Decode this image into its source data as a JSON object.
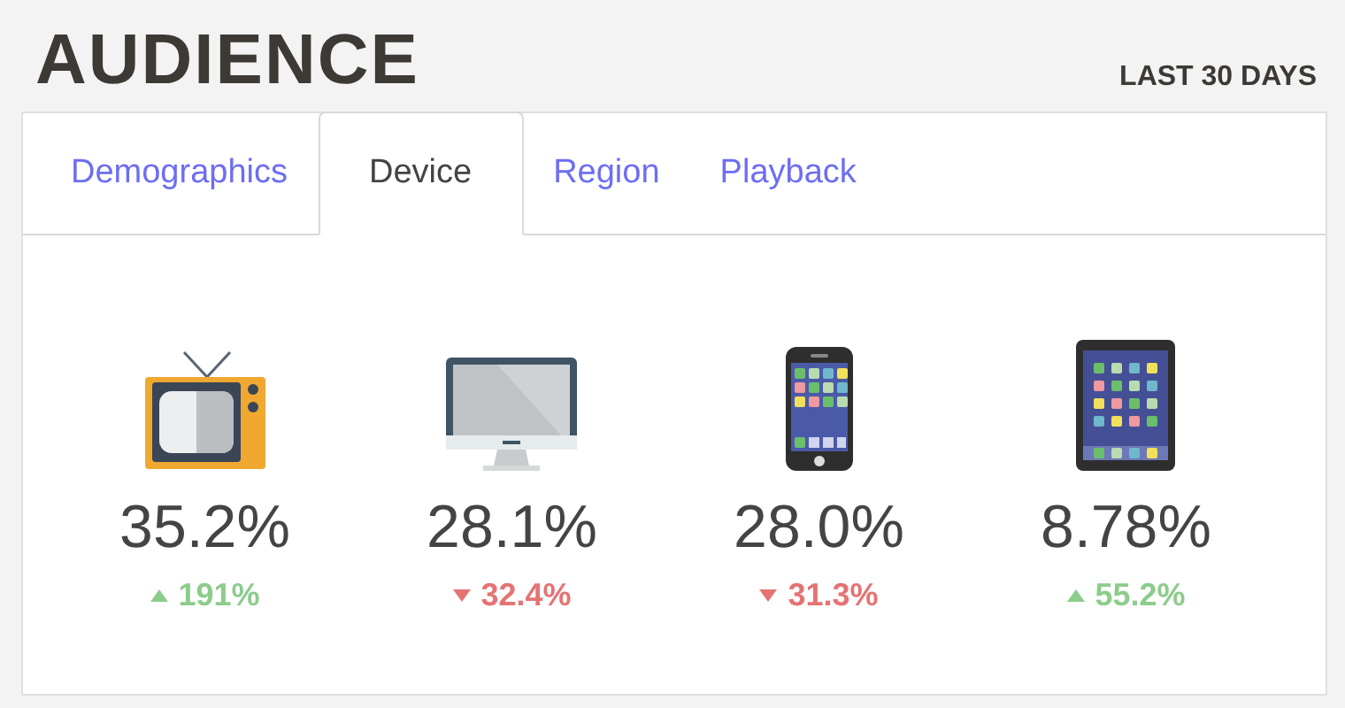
{
  "header": {
    "title": "AUDIENCE",
    "period": "LAST 30 DAYS"
  },
  "tabs": [
    {
      "label": "Demographics",
      "selected": false
    },
    {
      "label": "Device",
      "selected": true
    },
    {
      "label": "Region",
      "selected": false
    },
    {
      "label": "Playback",
      "selected": false
    }
  ],
  "devices": [
    {
      "kind": "tv",
      "share": "35.2%",
      "change": "191%",
      "increase": true
    },
    {
      "kind": "desktop",
      "share": "28.1%",
      "change": "32.4%",
      "increase": false
    },
    {
      "kind": "phone",
      "share": "28.0%",
      "change": "31.3%",
      "increase": false
    },
    {
      "kind": "tablet",
      "share": "8.78%",
      "change": "55.2%",
      "increase": true
    }
  ]
}
